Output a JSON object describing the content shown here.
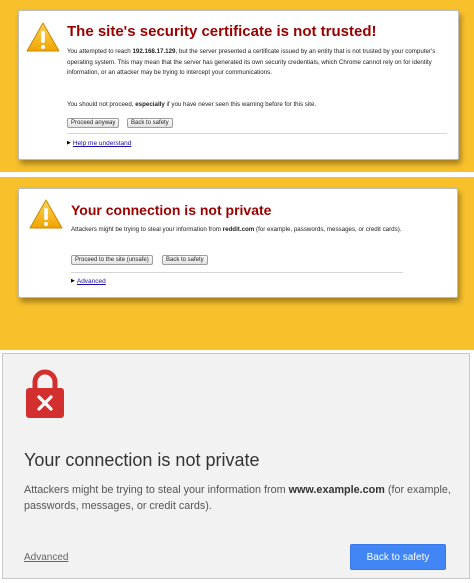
{
  "colors": {
    "warning_yellow": "#f8c12c",
    "title_red": "#9a0000",
    "lock_red": "#d32f2f",
    "button_blue": "#4285f4",
    "link_blue": "#1a0dab"
  },
  "panel1": {
    "icon": "warning-triangle-icon",
    "title": "The site's security certificate is not trusted!",
    "para1_prefix": "You attempted to reach ",
    "para1_host": "192.168.17.129",
    "para1_suffix": ", but the server presented a certificate issued by an entity that is not trusted by your computer's operating system. This may mean that the server has generated its own security credentials, which Chrome cannot rely on for identity information, or an attacker may be trying to intercept your communications.",
    "para2_prefix": "You should not proceed, ",
    "para2_bold": "especially",
    "para2_suffix": " if you have never seen this warning before for this site.",
    "proceed_label": "Proceed anyway",
    "back_label": "Back to safety",
    "help_link": "Help me understand"
  },
  "panel2": {
    "icon": "warning-triangle-icon",
    "title": "Your connection is not private",
    "para_prefix": "Attackers might be trying to steal your information from ",
    "para_host": "reddit.com",
    "para_suffix": " (for example, passwords, messages, or credit cards).",
    "proceed_label": "Proceed to the site (unsafe)",
    "back_label": "Back to safety",
    "advanced_link": "Advanced"
  },
  "panel3": {
    "icon": "lock-x-icon",
    "title": "Your connection is not private",
    "para_prefix": "Attackers might be trying to steal your information from ",
    "para_host": "www.example.com",
    "para_suffix": " (for example, passwords, messages, or credit cards).",
    "advanced_link": "Advanced",
    "back_label": "Back to safety"
  }
}
